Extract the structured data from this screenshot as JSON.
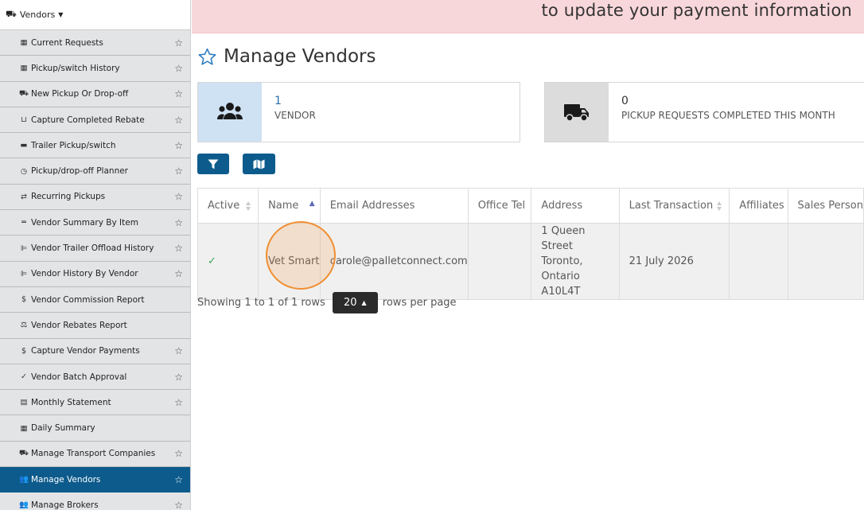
{
  "sidebar": {
    "section_label": "Vendors",
    "items": [
      {
        "label": "Current Requests",
        "icon": "table-icon",
        "glyph": "▦",
        "star": true,
        "active": false
      },
      {
        "label": "Pickup/switch History",
        "icon": "table-icon",
        "glyph": "▦",
        "star": true,
        "active": false
      },
      {
        "label": "New Pickup Or Drop-off",
        "icon": "dolly-icon",
        "glyph": "⛟",
        "star": true,
        "active": false
      },
      {
        "label": "Capture Completed Rebate",
        "icon": "pallet-icon",
        "glyph": "⊔",
        "star": true,
        "active": false
      },
      {
        "label": "Trailer Pickup/switch",
        "icon": "trailer-icon",
        "glyph": "▬",
        "star": true,
        "active": false
      },
      {
        "label": "Pickup/drop-off Planner",
        "icon": "clock-icon",
        "glyph": "◷",
        "star": true,
        "active": false
      },
      {
        "label": "Recurring Pickups",
        "icon": "sync-icon",
        "glyph": "⇄",
        "star": true,
        "active": false
      },
      {
        "label": "Vendor Summary By Item",
        "icon": "pallet-icon",
        "glyph": "═",
        "star": true,
        "active": false
      },
      {
        "label": "Vendor Trailer Offload History",
        "icon": "chart-icon",
        "glyph": "⊫",
        "star": true,
        "active": false
      },
      {
        "label": "Vendor History By Vendor",
        "icon": "chart-icon",
        "glyph": "⊫",
        "star": true,
        "active": false
      },
      {
        "label": "Vendor Commission Report",
        "icon": "dollar-icon",
        "glyph": "$",
        "star": false,
        "active": false
      },
      {
        "label": "Vendor Rebates Report",
        "icon": "balance-scale-icon",
        "glyph": "⚖",
        "star": false,
        "active": false
      },
      {
        "label": "Capture Vendor Payments",
        "icon": "dollar-icon",
        "glyph": "$",
        "star": true,
        "active": false
      },
      {
        "label": "Vendor Batch Approval",
        "icon": "check-icon",
        "glyph": "✓",
        "star": true,
        "active": false
      },
      {
        "label": "Monthly Statement",
        "icon": "list-icon",
        "glyph": "▤",
        "star": true,
        "active": false
      },
      {
        "label": "Daily Summary",
        "icon": "table-icon",
        "glyph": "▦",
        "star": false,
        "active": false
      },
      {
        "label": "Manage Transport Companies",
        "icon": "truck-icon",
        "glyph": "⛟",
        "star": true,
        "active": false
      },
      {
        "label": "Manage Vendors",
        "icon": "users-icon",
        "glyph": "👥",
        "star": true,
        "active": true
      },
      {
        "label": "Manage Brokers",
        "icon": "users-icon",
        "glyph": "👥",
        "star": true,
        "active": false
      }
    ]
  },
  "banner": {
    "text": "to update your payment information"
  },
  "page": {
    "title": "Manage Vendors"
  },
  "stats": {
    "vendors": {
      "value": "1",
      "label": "VENDOR"
    },
    "pickups": {
      "value": "0",
      "label": "PICKUP REQUESTS COMPLETED THIS MONTH"
    }
  },
  "table": {
    "columns": {
      "active": "Active",
      "name": "Name",
      "email": "Email Addresses",
      "office_tel": "Office Tel",
      "address": "Address",
      "last_transaction": "Last Transaction",
      "affiliates": "Affiliates",
      "sales_person": "Sales Person"
    },
    "rows": [
      {
        "active": "✓",
        "name": "Vet Smart",
        "email": "carole@palletconnect.com",
        "office_tel": "",
        "address_line1": "1 Queen Street",
        "address_line2": "Toronto, Ontario",
        "address_line3": "A10L4T",
        "last_transaction": "21 July 2026",
        "affiliates": "",
        "sales_person": ""
      }
    ]
  },
  "pagination": {
    "showing": "Showing 1 to 1 of 1 rows",
    "page_size": "20",
    "suffix": "rows per page"
  },
  "colors": {
    "accent": "#0d5b8c",
    "banner_bg": "#f8d7da",
    "click_highlight": "#ef8f32"
  }
}
